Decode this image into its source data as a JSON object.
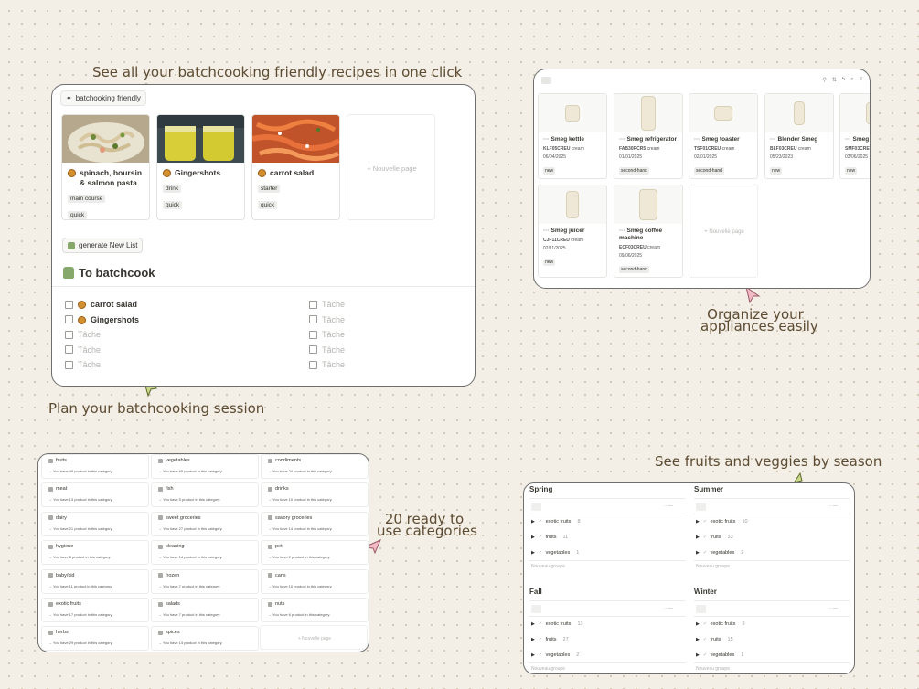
{
  "captions": {
    "recipes": "See all your batchcooking friendly recipes in one click",
    "plan": "Plan your batchcooking session",
    "appliances_line1": "Organize your",
    "appliances_line2": "appliances easily",
    "categories_line1": "20 ready to",
    "categories_line2": "use categories",
    "seasons": "See fruits and veggies by season"
  },
  "colors": {
    "background": "#f3efe6",
    "caption": "#5d4b32",
    "arrow_green": "#c9d88a",
    "arrow_pink": "#f0b9c3"
  },
  "recipes_panel": {
    "filter_label": "batchooking friendly",
    "cards": [
      {
        "title": "spinach, boursin & salmon pasta",
        "tags": [
          "main course",
          "quick"
        ]
      },
      {
        "title": "Gingershots",
        "tags": [
          "drink",
          "quick"
        ]
      },
      {
        "title": "carrot salad",
        "tags": [
          "starter",
          "quick"
        ]
      }
    ],
    "new_page": "Nouvelle page",
    "generate_button": "generate New List",
    "heading": "To batchcook",
    "todos_left": [
      {
        "label": "carrot salad",
        "placeholder": false
      },
      {
        "label": "Gingershots",
        "placeholder": false
      },
      {
        "label": "Tâche",
        "placeholder": true
      },
      {
        "label": "Tâche",
        "placeholder": true
      },
      {
        "label": "Tâche",
        "placeholder": true
      }
    ],
    "todos_right": [
      "Tâche",
      "Tâche",
      "Tâche",
      "Tâche",
      "Tâche"
    ]
  },
  "appliances_panel": {
    "items": [
      {
        "name": "Smeg kettle",
        "ref": "KLF05CREU",
        "color": "cream",
        "date": "06/04/2025",
        "tag": "new"
      },
      {
        "name": "Smeg refrigerator",
        "ref": "FAB30RCR5",
        "color": "cream",
        "date": "01/01/2025",
        "tag": "second-hand"
      },
      {
        "name": "Smeg toaster",
        "ref": "TSF01CREU",
        "color": "cream",
        "date": "02/01/2025",
        "tag": "second-hand"
      },
      {
        "name": "Blender Smeg",
        "ref": "BLF03CREU",
        "color": "cream",
        "date": "05/23/2023",
        "tag": "new"
      },
      {
        "name": "Smeg",
        "ref": "SMF03CREU",
        "color": "",
        "date": "03/06/2025",
        "tag": "new"
      },
      {
        "name": "Smeg juicer",
        "ref": "CJF11CREU",
        "color": "cream",
        "date": "02/11/2025",
        "tag": "new"
      },
      {
        "name": "Smeg coffee machine",
        "ref": "ECF03CREU",
        "color": "cream",
        "date": "09/06/2025",
        "tag": "second-hand"
      }
    ],
    "new_page": "Nouvelle page"
  },
  "categories_panel": {
    "items": [
      {
        "name": "fruits",
        "desc": "→ You have 48 product in this category."
      },
      {
        "name": "vegetables",
        "desc": "→ You have 69 product in this category."
      },
      {
        "name": "condiments",
        "desc": "→ You have 24 product in this category."
      },
      {
        "name": "meat",
        "desc": "→ You have 13 product in this category."
      },
      {
        "name": "fish",
        "desc": "→ You have 5 product in this category."
      },
      {
        "name": "drinks",
        "desc": "→ You have 10 product in this category."
      },
      {
        "name": "dairy",
        "desc": "→ You have 21 product in this category."
      },
      {
        "name": "sweet groceries",
        "desc": "→ You have 27 product in this category."
      },
      {
        "name": "savory groceries",
        "desc": "→ You have 14 product in this category."
      },
      {
        "name": "hygiene",
        "desc": "→ You have 5 product in this category."
      },
      {
        "name": "cleaning",
        "desc": "→ You have 14 product in this category."
      },
      {
        "name": "pet",
        "desc": "→ You have 2 product in this category."
      },
      {
        "name": "baby/kid",
        "desc": "→ You have 11 product in this category."
      },
      {
        "name": "frozen",
        "desc": "→ You have 7 product in this category."
      },
      {
        "name": "cans",
        "desc": "→ You have 10 product in this category."
      },
      {
        "name": "exotic fruits",
        "desc": "→ You have 17 product in this category."
      },
      {
        "name": "salads",
        "desc": "→ You have 7 product in this category."
      },
      {
        "name": "nuts",
        "desc": "→ You have 6 product in this category."
      },
      {
        "name": "herbs",
        "desc": "→ You have 29 product in this category."
      },
      {
        "name": "spices",
        "desc": "→ You have 14 product in this category."
      }
    ],
    "new_page": "Nouvelle page"
  },
  "seasons_panel": {
    "seasons": [
      {
        "name": "Spring",
        "rows": [
          {
            "label": "exotic fruits",
            "count": "8"
          },
          {
            "label": "fruits",
            "count": "11"
          },
          {
            "label": "vegetables",
            "count": "1"
          }
        ]
      },
      {
        "name": "Summer",
        "rows": [
          {
            "label": "exotic fruits",
            "count": "10"
          },
          {
            "label": "fruits",
            "count": "33"
          },
          {
            "label": "vegetables",
            "count": "2"
          }
        ]
      },
      {
        "name": "Fall",
        "rows": [
          {
            "label": "exotic fruits",
            "count": "13"
          },
          {
            "label": "fruits",
            "count": "27"
          },
          {
            "label": "vegetables",
            "count": "2"
          }
        ]
      },
      {
        "name": "Winter",
        "rows": [
          {
            "label": "exotic fruits",
            "count": "9"
          },
          {
            "label": "fruits",
            "count": "15"
          },
          {
            "label": "vegetables",
            "count": "1"
          }
        ]
      }
    ],
    "new_group": "Nouveau groupe"
  }
}
